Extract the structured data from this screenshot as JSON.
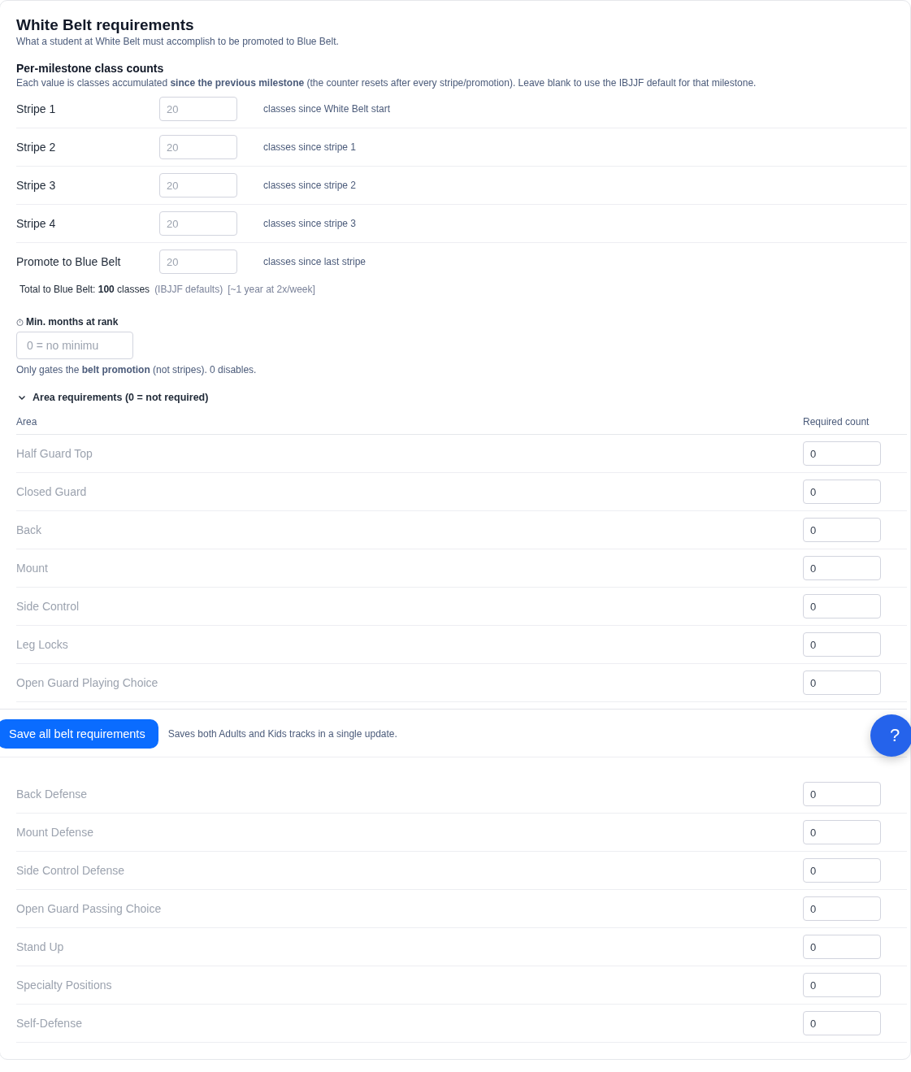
{
  "title": "White Belt requirements",
  "subtitle": "What a student at White Belt must accomplish to be promoted to Blue Belt.",
  "milestones": {
    "heading": "Per-milestone class counts",
    "description": "Each value is classes accumulated **since the previous milestone** (the counter resets after every stripe/promotion). Leave blank to use the IBJJF default for that milestone.",
    "rows": [
      {
        "label": "Stripe 1",
        "placeholder": "20",
        "hint": "classes since White Belt start"
      },
      {
        "label": "Stripe 2",
        "placeholder": "20",
        "hint": "classes since stripe 1"
      },
      {
        "label": "Stripe 3",
        "placeholder": "20",
        "hint": "classes since stripe 2"
      },
      {
        "label": "Stripe 4",
        "placeholder": "20",
        "hint": "classes since stripe 3"
      },
      {
        "label": "Promote to Blue Belt",
        "placeholder": "20",
        "hint": "classes since last stripe"
      }
    ],
    "total": "Total to Blue Belt: **100** classes",
    "total_source": "(IBJJF defaults)",
    "total_estimate": "[~1 year at 2x/week]"
  },
  "min_months": {
    "label": "Min. months at rank",
    "placeholder": "0 = no minimu",
    "note": "Only gates the **belt promotion** (not stripes). 0 disables."
  },
  "areas": {
    "toggle": "Area requirements (0 = not required)",
    "expanded": true,
    "columns": [
      "Area",
      "Required count"
    ],
    "rows_before": [
      {
        "area": "Half Guard Top",
        "count": "0"
      },
      {
        "area": "Closed Guard",
        "count": "0"
      },
      {
        "area": "Back",
        "count": "0"
      },
      {
        "area": "Mount",
        "count": "0"
      },
      {
        "area": "Side Control",
        "count": "0"
      },
      {
        "area": "Leg Locks",
        "count": "0"
      },
      {
        "area": "Open Guard Playing Choice",
        "count": "0"
      }
    ],
    "rows_after": [
      {
        "area": "Back Defense",
        "count": "0"
      },
      {
        "area": "Mount Defense",
        "count": "0"
      },
      {
        "area": "Side Control Defense",
        "count": "0"
      },
      {
        "area": "Open Guard Passing Choice",
        "count": "0"
      },
      {
        "area": "Stand Up",
        "count": "0"
      },
      {
        "area": "Specialty Positions",
        "count": "0"
      },
      {
        "area": "Self-Defense",
        "count": "0"
      }
    ]
  },
  "save_bar": {
    "button": "Save all belt requirements",
    "note": "Saves both Adults and Kids tracks in a single update."
  },
  "help_button": "?"
}
